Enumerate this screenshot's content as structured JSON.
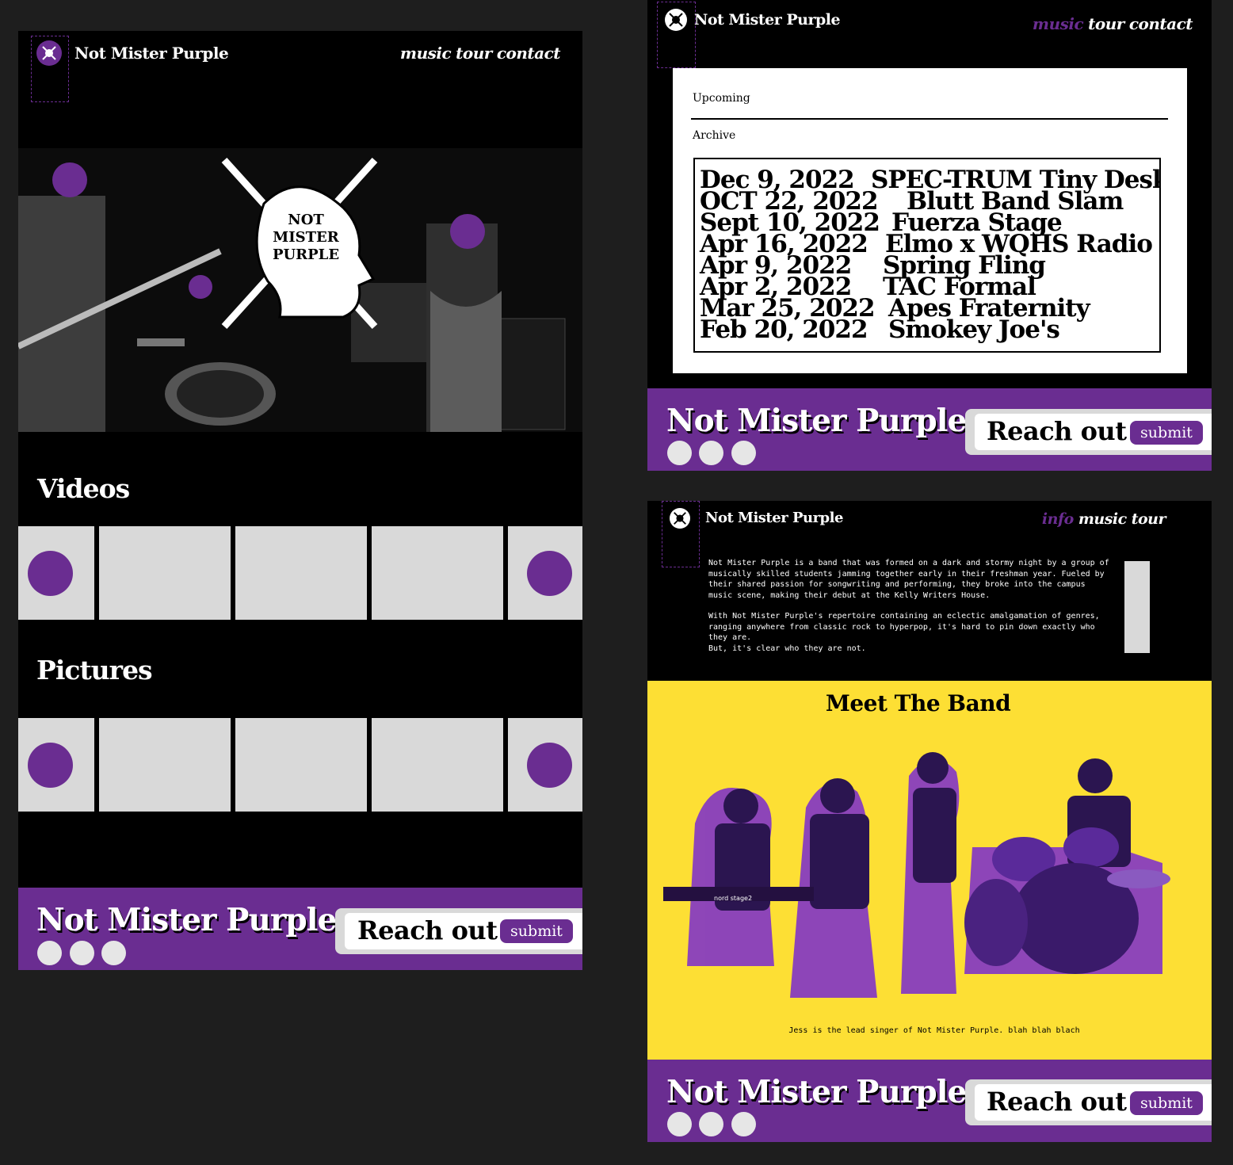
{
  "brand": "Not Mister Purple",
  "colors": {
    "purple": "#6a2d91",
    "yellow": "#fddf34",
    "gray": "#d9d9d9",
    "background": "#1e1e1e"
  },
  "home": {
    "nav": [
      "music",
      "tour",
      "contact"
    ],
    "hero_logo_text": "NOT MISTER PURPLE",
    "videos_title": "Videos",
    "pictures_title": "Pictures"
  },
  "tour_page": {
    "nav": [
      "music",
      "tour",
      "contact"
    ],
    "active_nav": "music",
    "tabs": {
      "upcoming": "Upcoming",
      "archive": "Archive"
    },
    "shows": [
      {
        "date": "Dec 9, 2022",
        "venue": "SPEC-TRUM Tiny Desk"
      },
      {
        "date": "OCT 22, 2022",
        "venue": "Blutt Band Slam"
      },
      {
        "date": "Sept 10, 2022",
        "venue": "Fuerza Stage"
      },
      {
        "date": "Apr 16, 2022",
        "venue": "Elmo x WQHS Radio"
      },
      {
        "date": "Apr 9, 2022",
        "venue": "Spring Fling"
      },
      {
        "date": "Apr 2, 2022",
        "venue": "TAC Formal"
      },
      {
        "date": "Mar 25, 2022",
        "venue": "Apes Fraternity"
      },
      {
        "date": "Feb 20, 2022",
        "venue": "Smokey Joe's"
      }
    ]
  },
  "info_page": {
    "nav": [
      "info",
      "music",
      "tour"
    ],
    "active_nav": "info",
    "about_p1": "Not Mister Purple is a band that was formed on a dark and stormy night by a group of musically skilled students jamming together early in their freshman year. Fueled by their shared passion for songwriting and performing, they broke into the campus music scene, making their debut at the Kelly Writers House.",
    "about_p2": "With Not Mister Purple's repertoire containing an eclectic amalgamation of genres, ranging anywhere from classic rock to hyperpop, it's hard to pin down exactly who they are.",
    "about_p3": "But, it's clear who they are not.",
    "meet_title": "Meet The Band",
    "caption": "Jess is the lead singer of Not Mister Purple. blah blah blach",
    "keyboard_label": "nord stage2"
  },
  "footer": {
    "title": "Not Mister Purple",
    "reach_out": "Reach out",
    "submit": "submit"
  }
}
